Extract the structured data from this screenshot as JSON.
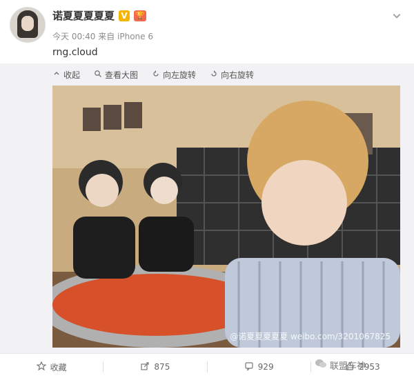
{
  "user": {
    "name": "诺夏夏夏夏夏",
    "verified_badge": "V",
    "level_badge": "🏆"
  },
  "post": {
    "meta": "今天 00:40 来自 iPhone 6",
    "text": "rng.cloud"
  },
  "toolbar": {
    "items": [
      {
        "label": "收起",
        "icon": "collapse-icon"
      },
      {
        "label": "查看大图",
        "icon": "zoom-icon"
      },
      {
        "label": "向左旋转",
        "icon": "rotate-left-icon"
      },
      {
        "label": "向右旋转",
        "icon": "rotate-right-icon"
      }
    ]
  },
  "photo": {
    "watermark": "@诺夏夏夏夏夏 weibo.com/3201067825"
  },
  "footer": {
    "favorite_label": "收藏",
    "repost_count": "875",
    "comment_count": "929",
    "like_count": "2953"
  },
  "brand": {
    "label": "联盟车神"
  },
  "colors": {
    "accent": "#f7b500",
    "panel_bg": "#f2f2f5",
    "text": "#333333",
    "muted": "#8c8c8c"
  }
}
